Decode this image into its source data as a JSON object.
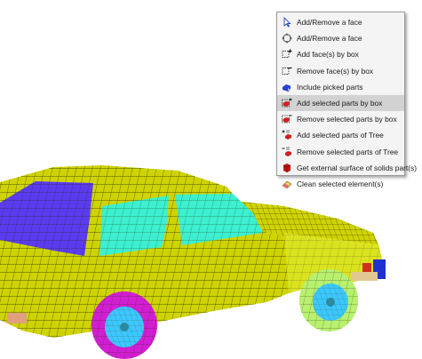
{
  "context_menu": {
    "highlighted_index": 5,
    "items": [
      {
        "label": "Add/Remove a face",
        "icon": "arrow-cursor-icon"
      },
      {
        "label": "Add/Remove a face",
        "icon": "crosshair-cursor-icon"
      },
      {
        "label": "Add face(s) by box",
        "icon": "add-box-icon"
      },
      {
        "label": "Remove face(s) by box",
        "icon": "remove-box-icon"
      },
      {
        "label": "Include picked parts",
        "icon": "include-parts-icon"
      },
      {
        "label": "Add selected parts by box",
        "icon": "add-parts-box-icon"
      },
      {
        "label": "Remove selected parts by box",
        "icon": "remove-parts-box-icon"
      },
      {
        "label": "Add selected parts of Tree",
        "icon": "add-tree-parts-icon"
      },
      {
        "label": "Remove selected parts of Tree",
        "icon": "remove-tree-parts-icon"
      },
      {
        "label": "Get external surface of solids part(s)",
        "icon": "solid-surface-icon"
      },
      {
        "label": "Clean selected element(s)",
        "icon": "eraser-icon"
      }
    ]
  },
  "model_colors": {
    "body": "#cfd400",
    "side_window": "#5b3cf0",
    "windows": "#3cf0d0",
    "tire": "#d21ed2",
    "hub": "#3cc8ff",
    "mesh_line": "#2a2a00"
  }
}
